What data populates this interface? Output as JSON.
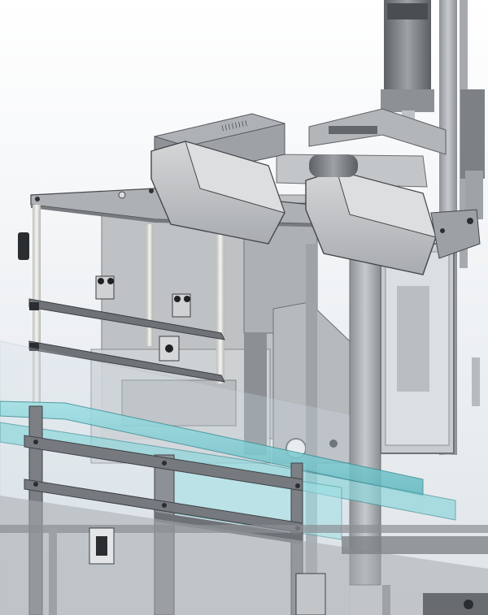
{
  "viewport": {
    "name": "cad-assembly-viewport",
    "background_top": "#ffffff",
    "background_bottom": "#dfe4e8"
  },
  "palette": {
    "frame": "#9a9ea3",
    "frame_dark": "#6c7075",
    "frame_light": "#c9ccd0",
    "panel": "#b9bcbf",
    "motor": "#7f8488",
    "guard_glass": "#cfe0ea",
    "conveyor_cyan": "#7fd0d6",
    "conveyor_dark": "#4c9fa6",
    "bolt": "#3d4044",
    "rod": "#e6e6e4"
  },
  "label_plate_text": "||||||||"
}
